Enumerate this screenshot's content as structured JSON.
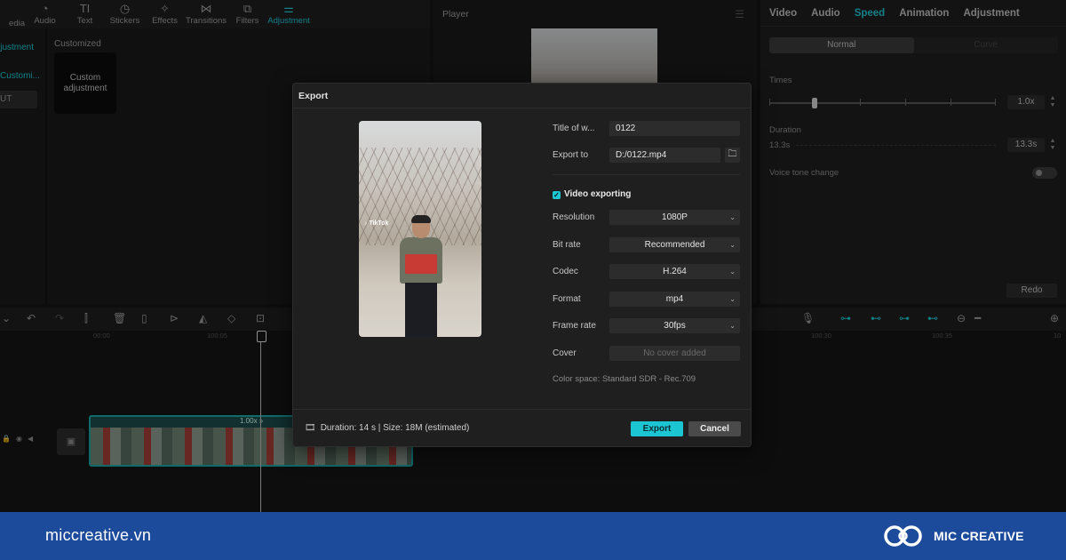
{
  "toolbar": {
    "items": [
      {
        "label": "edia",
        "icon": "media-icon"
      },
      {
        "label": "Audio",
        "icon": "audio-icon"
      },
      {
        "label": "Text",
        "icon": "text-icon"
      },
      {
        "label": "Stickers",
        "icon": "sticker-icon"
      },
      {
        "label": "Effects",
        "icon": "effects-icon"
      },
      {
        "label": "Transitions",
        "icon": "transitions-icon"
      },
      {
        "label": "Filters",
        "icon": "filters-icon"
      },
      {
        "label": "Adjustment",
        "icon": "adjustment-icon",
        "active": true
      }
    ]
  },
  "sidebar": {
    "items": [
      "Adjustment",
      "Customi...",
      "UT"
    ]
  },
  "browser": {
    "section_label": "Customized",
    "card_label": "Custom adjustment"
  },
  "player": {
    "title": "Player"
  },
  "right_panel": {
    "tabs": [
      "Video",
      "Audio",
      "Speed",
      "Animation",
      "Adjustment"
    ],
    "active_tab": "Speed",
    "segments": [
      "Normal",
      "Curve"
    ],
    "times_label": "Times",
    "times_value": "1.0x",
    "duration_label": "Duration",
    "duration_start": "13.3s",
    "duration_value": "13.3s",
    "voice_label": "Voice tone change",
    "redo_label": "Redo"
  },
  "timeline": {
    "ruler_labels": [
      "00:00",
      "100:05",
      "100:30",
      "100:35",
      "10"
    ],
    "clip_speed": "1.00x »"
  },
  "export_dialog": {
    "title": "Export",
    "preview_watermark": "♪ TikTok",
    "fields": {
      "title_label": "Title of w...",
      "title_value": "0122",
      "export_to_label": "Export to",
      "export_to_value": "D:/0122.mp4"
    },
    "video_exporting_label": "Video exporting",
    "settings": [
      {
        "label": "Resolution",
        "value": "1080P"
      },
      {
        "label": "Bit rate",
        "value": "Recommended"
      },
      {
        "label": "Codec",
        "value": "H.264"
      },
      {
        "label": "Format",
        "value": "mp4"
      },
      {
        "label": "Frame rate",
        "value": "30fps"
      }
    ],
    "cover_label": "Cover",
    "cover_value": "No cover added",
    "color_space": "Color space: Standard SDR - Rec.709",
    "footer_info": "Duration: 14 s | Size: 18M (estimated)",
    "export_button": "Export",
    "cancel_button": "Cancel"
  },
  "banner": {
    "site": "miccreative.vn",
    "brand": "MIC CREATIVE"
  },
  "colors": {
    "accent": "#1bc5d2",
    "banner": "#1c4b9c",
    "dialog_bg": "#1f1f1f"
  }
}
